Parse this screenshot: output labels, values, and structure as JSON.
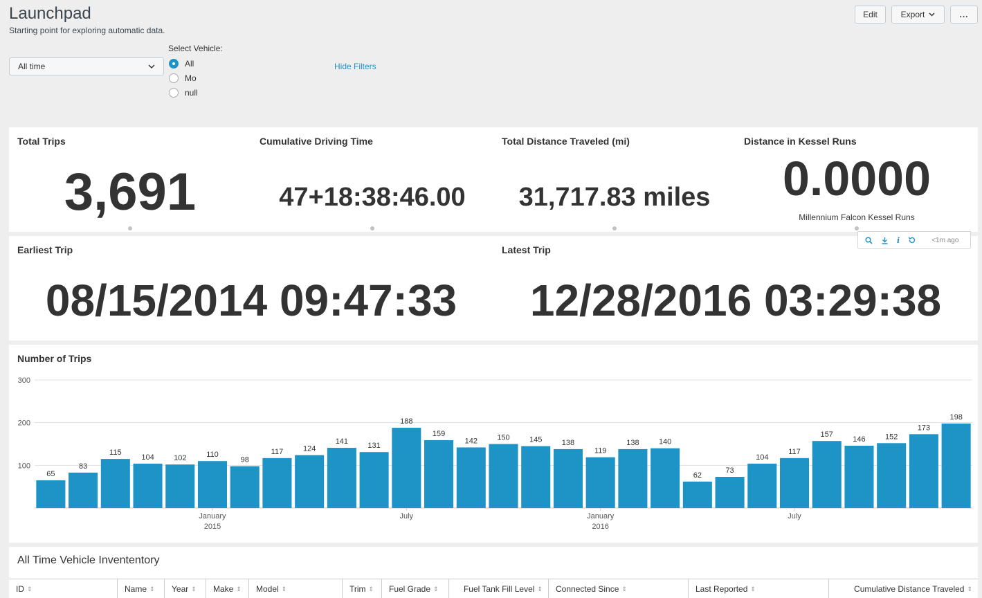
{
  "header": {
    "title": "Launchpad",
    "subtitle": "Starting point for exploring automatic data.",
    "edit_label": "Edit",
    "export_label": "Export",
    "more_label": "..."
  },
  "filters": {
    "time_value": "All time",
    "vehicle_label": "Select Vehicle:",
    "vehicle_options": [
      {
        "label": "All",
        "selected": true
      },
      {
        "label": "Mo",
        "selected": false
      },
      {
        "label": "null",
        "selected": false
      }
    ],
    "hide_filters_label": "Hide Filters"
  },
  "stats": {
    "total_trips": {
      "title": "Total Trips",
      "value": "3,691"
    },
    "driving_time": {
      "title": "Cumulative Driving Time",
      "value": "47+18:38:46.00"
    },
    "distance": {
      "title": "Total Distance Traveled (mi)",
      "value": "31,717.83 miles"
    },
    "kessel": {
      "title": "Distance in Kessel Runs",
      "value": "0.0000",
      "caption": "Millennium Falcon Kessel Runs"
    },
    "earliest": {
      "title": "Earliest Trip",
      "value": "08/15/2014 09:47:33"
    },
    "latest": {
      "title": "Latest Trip",
      "value": "12/28/2016 03:29:38"
    }
  },
  "panel_toolbar": {
    "ago": "<1m ago"
  },
  "colors": {
    "accent": "#1e93c6",
    "bar": "#1e93c6"
  },
  "chart_data": {
    "type": "bar",
    "title": "Number of Trips",
    "values": [
      65,
      83,
      115,
      104,
      102,
      110,
      98,
      117,
      124,
      141,
      131,
      188,
      159,
      142,
      150,
      145,
      138,
      119,
      138,
      140,
      62,
      73,
      104,
      117,
      157,
      146,
      152,
      173,
      198
    ],
    "ylim": [
      0,
      300
    ],
    "yticks": [
      100,
      200,
      300
    ],
    "xtick_labels": [
      {
        "index": 5,
        "lines": [
          "January",
          "2015"
        ]
      },
      {
        "index": 11,
        "lines": [
          "July"
        ]
      },
      {
        "index": 17,
        "lines": [
          "January",
          "2016"
        ]
      },
      {
        "index": 23,
        "lines": [
          "July"
        ]
      }
    ],
    "grid": true
  },
  "inventory": {
    "title": "All Time Vehicle Invententory",
    "columns": [
      "ID",
      "Name",
      "Year",
      "Make",
      "Model",
      "Trim",
      "Fuel Grade",
      "Fuel Tank Fill Level",
      "Connected Since",
      "Last Reported",
      "Cumulative Distance Traveled"
    ]
  }
}
